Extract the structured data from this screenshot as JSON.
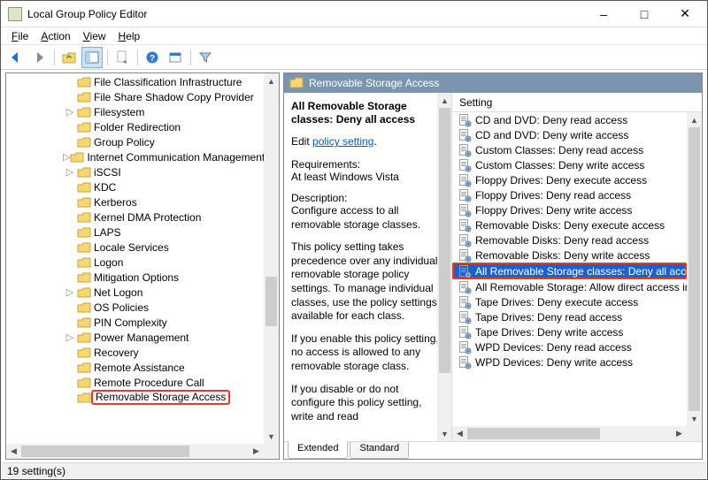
{
  "window": {
    "title": "Local Group Policy Editor"
  },
  "menu": {
    "file": "File",
    "action": "Action",
    "view": "View",
    "help": "Help"
  },
  "tree": {
    "items": [
      {
        "indent": 4,
        "twisty": "",
        "label": "File Classification Infrastructure"
      },
      {
        "indent": 4,
        "twisty": "",
        "label": "File Share Shadow Copy Provider"
      },
      {
        "indent": 4,
        "twisty": "▷",
        "label": "Filesystem"
      },
      {
        "indent": 4,
        "twisty": "",
        "label": "Folder Redirection"
      },
      {
        "indent": 4,
        "twisty": "",
        "label": "Group Policy"
      },
      {
        "indent": 4,
        "twisty": "▷",
        "label": "Internet Communication Management"
      },
      {
        "indent": 4,
        "twisty": "▷",
        "label": "iSCSI"
      },
      {
        "indent": 4,
        "twisty": "",
        "label": "KDC"
      },
      {
        "indent": 4,
        "twisty": "",
        "label": "Kerberos"
      },
      {
        "indent": 4,
        "twisty": "",
        "label": "Kernel DMA Protection"
      },
      {
        "indent": 4,
        "twisty": "",
        "label": "LAPS"
      },
      {
        "indent": 4,
        "twisty": "",
        "label": "Locale Services"
      },
      {
        "indent": 4,
        "twisty": "",
        "label": "Logon"
      },
      {
        "indent": 4,
        "twisty": "",
        "label": "Mitigation Options"
      },
      {
        "indent": 4,
        "twisty": "▷",
        "label": "Net Logon"
      },
      {
        "indent": 4,
        "twisty": "",
        "label": "OS Policies"
      },
      {
        "indent": 4,
        "twisty": "",
        "label": "PIN Complexity"
      },
      {
        "indent": 4,
        "twisty": "▷",
        "label": "Power Management"
      },
      {
        "indent": 4,
        "twisty": "",
        "label": "Recovery"
      },
      {
        "indent": 4,
        "twisty": "",
        "label": "Remote Assistance"
      },
      {
        "indent": 4,
        "twisty": "",
        "label": "Remote Procedure Call"
      },
      {
        "indent": 4,
        "twisty": "",
        "label": "Removable Storage Access",
        "highlight": true
      }
    ]
  },
  "right": {
    "category_title": "Removable Storage Access",
    "desc": {
      "item_title": "All Removable Storage classes: Deny all access",
      "edit_prefix": "Edit",
      "edit_link": "policy setting",
      "req_label": "Requirements:",
      "req_value": "At least Windows Vista",
      "desc_label": "Description:",
      "p1": "Configure access to all removable storage classes.",
      "p2": "This policy setting takes precedence over any individual removable storage policy settings. To manage individual classes, use the policy settings available for each class.",
      "p3": "If you enable this policy setting, no access is allowed to any removable storage class.",
      "p4": "If you disable or do not configure this policy setting, write and read"
    },
    "col_header": "Setting",
    "items": [
      {
        "label": "CD and DVD: Deny read access"
      },
      {
        "label": "CD and DVD: Deny write access"
      },
      {
        "label": "Custom Classes: Deny read access"
      },
      {
        "label": "Custom Classes: Deny write access"
      },
      {
        "label": "Floppy Drives: Deny execute access"
      },
      {
        "label": "Floppy Drives: Deny read access"
      },
      {
        "label": "Floppy Drives: Deny write access"
      },
      {
        "label": "Removable Disks: Deny execute access"
      },
      {
        "label": "Removable Disks: Deny read access"
      },
      {
        "label": "Removable Disks: Deny write access"
      },
      {
        "label": "All Removable Storage classes: Deny all access",
        "selected": true
      },
      {
        "label": "All Removable Storage: Allow direct access in remote sessions"
      },
      {
        "label": "Tape Drives: Deny execute access"
      },
      {
        "label": "Tape Drives: Deny read access"
      },
      {
        "label": "Tape Drives: Deny write access"
      },
      {
        "label": "WPD Devices: Deny read access"
      },
      {
        "label": "WPD Devices: Deny write access"
      }
    ],
    "tabs": {
      "extended": "Extended",
      "standard": "Standard"
    }
  },
  "status": {
    "text": "19 setting(s)"
  }
}
